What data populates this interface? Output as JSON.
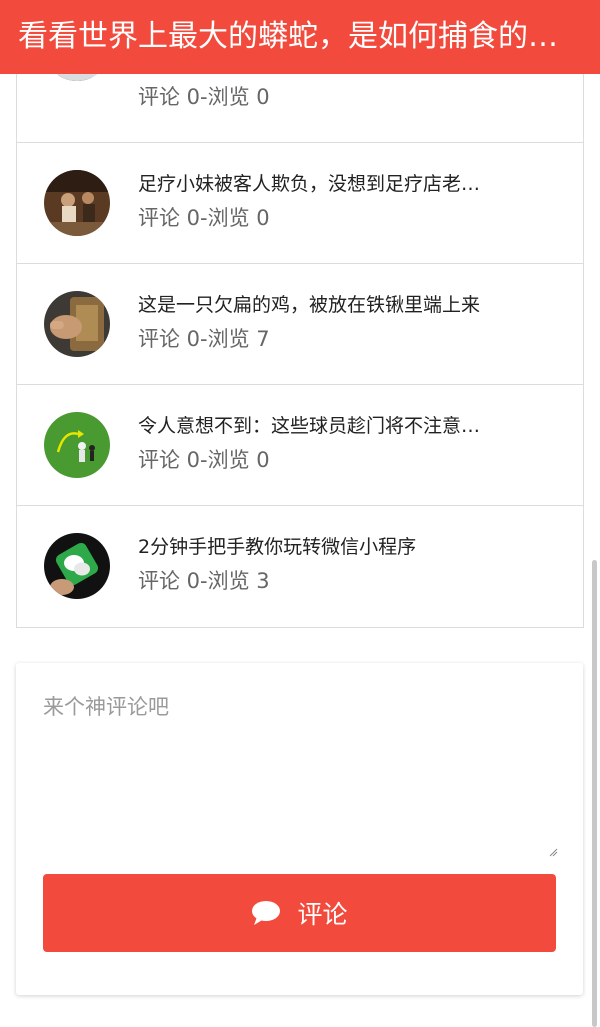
{
  "header": {
    "title": "看看世界上最大的蟒蛇，是如何捕食的，被吓到了"
  },
  "list": {
    "items": [
      {
        "title": "",
        "meta": "评论 0-浏览 0",
        "thumb": "person-icon"
      },
      {
        "title": "足疗小妹被客人欺负，没想到足疗店老板竟然",
        "meta": "评论 0-浏览 0",
        "thumb": "room-icon"
      },
      {
        "title": "这是一只欠扁的鸡，被放在铁锹里端上来",
        "meta": "评论 0-浏览 7",
        "thumb": "hand-icon"
      },
      {
        "title": "令人意想不到：这些球员趁门将不注意的进球",
        "meta": "评论 0-浏览 0",
        "thumb": "soccer-icon"
      },
      {
        "title": "2分钟手把手教你玩转微信小程序",
        "meta": "评论 0-浏览 3",
        "thumb": "wechat-icon"
      }
    ]
  },
  "comment": {
    "placeholder": "来个神评论吧",
    "value": "",
    "button_label": "评论",
    "button_icon": "chat-bubble-icon"
  },
  "colors": {
    "accent": "#f24a3c"
  }
}
